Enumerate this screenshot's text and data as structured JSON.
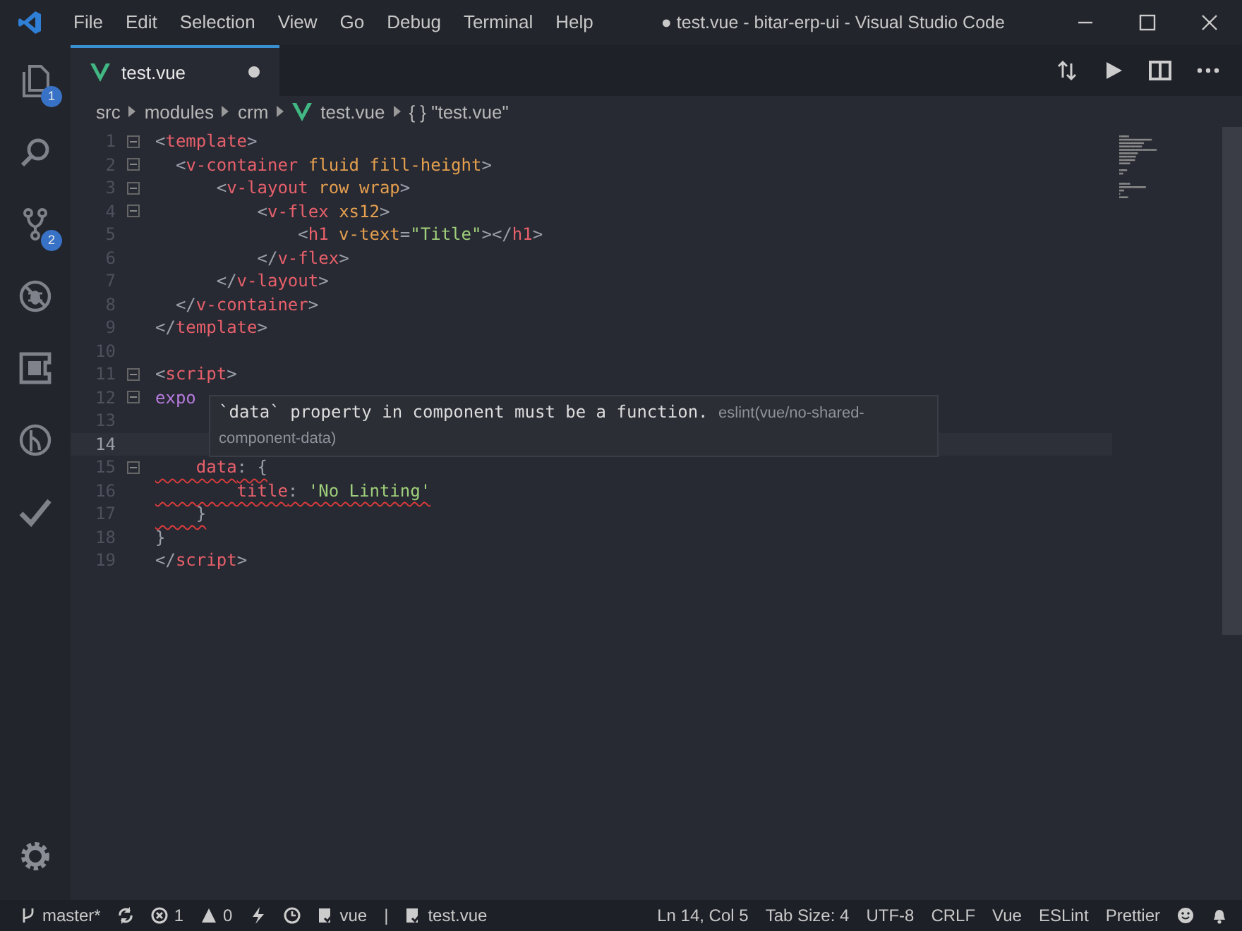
{
  "window": {
    "title": "● test.vue - bitar-erp-ui - Visual Studio Code"
  },
  "menu": [
    {
      "label": "File"
    },
    {
      "label": "Edit"
    },
    {
      "label": "Selection"
    },
    {
      "label": "View"
    },
    {
      "label": "Go"
    },
    {
      "label": "Debug"
    },
    {
      "label": "Terminal"
    },
    {
      "label": "Help"
    }
  ],
  "activity_bar": [
    {
      "kind": "explorer",
      "selected": false,
      "badge": "1"
    },
    {
      "kind": "search",
      "selected": false
    },
    {
      "kind": "scm",
      "selected": false,
      "badge": "2"
    },
    {
      "kind": "debug",
      "selected": false
    },
    {
      "kind": "extensions",
      "selected": false
    },
    {
      "kind": "graph",
      "selected": false
    },
    {
      "kind": "check",
      "selected": false
    }
  ],
  "tabs": [
    {
      "label": "test.vue",
      "selected": true,
      "dirty": true
    }
  ],
  "breadcrumb": [
    {
      "label": "src",
      "kind": "text"
    },
    {
      "label": "modules",
      "kind": "text"
    },
    {
      "label": "crm",
      "kind": "text"
    },
    {
      "label": "test.vue",
      "kind": "vue"
    },
    {
      "label": "{ } \"test.vue\"",
      "kind": "text"
    }
  ],
  "editor": {
    "lines": [
      {
        "number": "1",
        "fold": true,
        "current": false,
        "tokens": [
          {
            "t": "<",
            "kind": "punct"
          },
          {
            "t": "template",
            "kind": "tag"
          },
          {
            "t": ">",
            "kind": "punct"
          }
        ]
      },
      {
        "number": "2",
        "fold": true,
        "current": false,
        "tokens": [
          {
            "t": "  <",
            "kind": "punct"
          },
          {
            "t": "v-container",
            "kind": "tag"
          },
          {
            "t": " fluid fill-height",
            "kind": "attr"
          },
          {
            "t": ">",
            "kind": "punct"
          }
        ]
      },
      {
        "number": "3",
        "fold": true,
        "current": false,
        "tokens": [
          {
            "t": "      <",
            "kind": "punct"
          },
          {
            "t": "v-layout",
            "kind": "tag"
          },
          {
            "t": " row wrap",
            "kind": "attr"
          },
          {
            "t": ">",
            "kind": "punct"
          }
        ]
      },
      {
        "number": "4",
        "fold": true,
        "current": false,
        "tokens": [
          {
            "t": "          <",
            "kind": "punct"
          },
          {
            "t": "v-flex",
            "kind": "tag"
          },
          {
            "t": " xs12",
            "kind": "attr"
          },
          {
            "t": ">",
            "kind": "punct"
          }
        ]
      },
      {
        "number": "5",
        "fold": false,
        "current": false,
        "tokens": [
          {
            "t": "              <",
            "kind": "punct"
          },
          {
            "t": "h1",
            "kind": "tag"
          },
          {
            "t": " v-text",
            "kind": "attr"
          },
          {
            "t": "=",
            "kind": "punct"
          },
          {
            "t": "\"Title\"",
            "kind": "str"
          },
          {
            "t": "></",
            "kind": "punct"
          },
          {
            "t": "h1",
            "kind": "tag"
          },
          {
            "t": ">",
            "kind": "punct"
          }
        ]
      },
      {
        "number": "6",
        "fold": false,
        "current": false,
        "tokens": [
          {
            "t": "          </",
            "kind": "punct"
          },
          {
            "t": "v-flex",
            "kind": "tag"
          },
          {
            "t": ">",
            "kind": "punct"
          }
        ]
      },
      {
        "number": "7",
        "fold": false,
        "current": false,
        "tokens": [
          {
            "t": "      </",
            "kind": "punct"
          },
          {
            "t": "v-layout",
            "kind": "tag"
          },
          {
            "t": ">",
            "kind": "punct"
          }
        ]
      },
      {
        "number": "8",
        "fold": false,
        "current": false,
        "tokens": [
          {
            "t": "  </",
            "kind": "punct"
          },
          {
            "t": "v-container",
            "kind": "tag"
          },
          {
            "t": ">",
            "kind": "punct"
          }
        ]
      },
      {
        "number": "9",
        "fold": false,
        "current": false,
        "tokens": [
          {
            "t": "</",
            "kind": "punct"
          },
          {
            "t": "template",
            "kind": "tag"
          },
          {
            "t": ">",
            "kind": "punct"
          }
        ]
      },
      {
        "number": "10",
        "fold": false,
        "current": false
      },
      {
        "number": "11",
        "fold": true,
        "current": false,
        "tokens": [
          {
            "t": "<",
            "kind": "punct"
          },
          {
            "t": "script",
            "kind": "tag"
          },
          {
            "t": ">",
            "kind": "punct"
          }
        ]
      },
      {
        "number": "12",
        "fold": true,
        "current": false,
        "tokens": [
          {
            "t": "expo",
            "kind": "keyword"
          }
        ]
      },
      {
        "number": "13",
        "fold": false,
        "current": false
      },
      {
        "number": "14",
        "fold": false,
        "current": true
      },
      {
        "number": "15",
        "fold": true,
        "current": false,
        "tokens": [
          {
            "t": "    data",
            "kind": "prop",
            "squiggle": true
          },
          {
            "t": ": {",
            "kind": "punct",
            "squiggle": true
          }
        ]
      },
      {
        "number": "16",
        "fold": false,
        "current": false,
        "tokens": [
          {
            "t": "        title",
            "kind": "prop",
            "squiggle": true
          },
          {
            "t": ": ",
            "kind": "punct",
            "squiggle": true
          },
          {
            "t": "'No Linting'",
            "kind": "str",
            "squiggle": true
          }
        ]
      },
      {
        "number": "17",
        "fold": false,
        "current": false,
        "tokens": [
          {
            "t": "    }",
            "kind": "punct",
            "squiggle": true
          }
        ]
      },
      {
        "number": "18",
        "fold": false,
        "current": false,
        "tokens": [
          {
            "t": "}",
            "kind": "punct"
          }
        ]
      },
      {
        "number": "19",
        "fold": false,
        "current": false,
        "tokens": [
          {
            "t": "</",
            "kind": "punct"
          },
          {
            "t": "script",
            "kind": "tag"
          },
          {
            "t": ">",
            "kind": "punct"
          }
        ]
      }
    ]
  },
  "hover": {
    "message": "`data` property in component must be a function.",
    "source": "eslint(vue/no-shared-component-data)"
  },
  "status_bar": {
    "left": [
      {
        "kind": "branch",
        "label": "master*"
      },
      {
        "kind": "sync"
      },
      {
        "kind": "errors",
        "label": "1"
      },
      {
        "kind": "warnings",
        "label": "0"
      },
      {
        "kind": "bolt"
      },
      {
        "kind": "clock"
      },
      {
        "kind": "lint",
        "label": "vue"
      },
      {
        "kind": "text",
        "label": "|"
      },
      {
        "kind": "lint",
        "label": "test.vue"
      }
    ],
    "right": [
      {
        "kind": "text",
        "label": "Ln 14, Col 5"
      },
      {
        "kind": "text",
        "label": "Tab Size: 4"
      },
      {
        "kind": "text",
        "label": "UTF-8"
      },
      {
        "kind": "text",
        "label": "CRLF"
      },
      {
        "kind": "text",
        "label": "Vue"
      },
      {
        "kind": "text",
        "label": "ESLint"
      },
      {
        "kind": "text",
        "label": "Prettier"
      },
      {
        "kind": "smiley"
      },
      {
        "kind": "bell"
      }
    ]
  }
}
